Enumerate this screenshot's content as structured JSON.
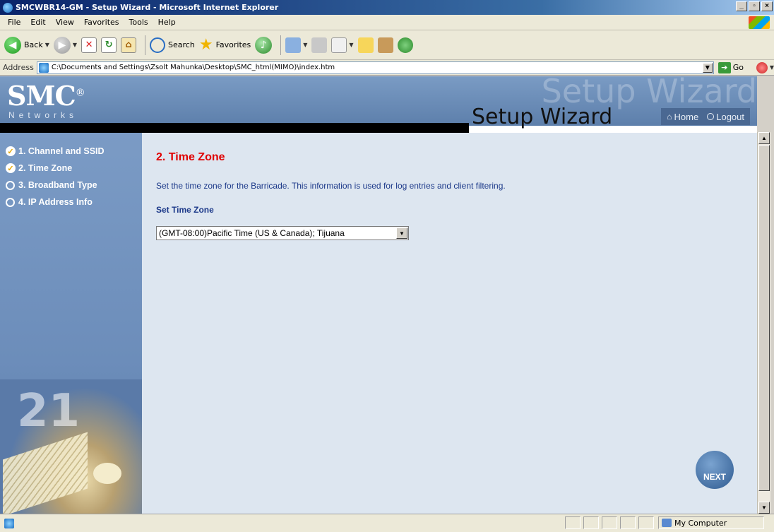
{
  "window": {
    "title": "SMCWBR14-GM - Setup Wizard - Microsoft Internet Explorer",
    "min": "_",
    "max": "▫",
    "close": "×"
  },
  "menu": {
    "items": [
      "File",
      "Edit",
      "View",
      "Favorites",
      "Tools",
      "Help"
    ]
  },
  "toolbar": {
    "back_label": "Back",
    "search_label": "Search",
    "favorites_label": "Favorites"
  },
  "address": {
    "label": "Address",
    "url": "C:\\Documents and Settings\\Zsolt Mahunka\\Desktop\\SMC_html(MIMO)\\index.htm",
    "go_label": "Go"
  },
  "header": {
    "logo": "SMC",
    "logo_mark": "®",
    "networks": "Networks",
    "ghost_title": "Setup Wizard",
    "title": "Setup Wizard",
    "home": "Home",
    "logout": "Logout"
  },
  "steps": [
    {
      "label": "1. Channel and SSID",
      "done": true
    },
    {
      "label": "2. Time Zone",
      "done": true
    },
    {
      "label": "3. Broadband Type",
      "done": false
    },
    {
      "label": "4. IP Address Info",
      "done": false
    }
  ],
  "art": {
    "text": "21"
  },
  "main": {
    "title": "2. Time Zone",
    "description": "Set the time zone for the Barricade. This information is used for log entries and client filtering.",
    "field_label": "Set Time Zone",
    "timezone_value": "(GMT-08:00)Pacific Time (US & Canada); Tijuana",
    "next_label": "NEXT"
  },
  "status": {
    "zone": "My Computer"
  },
  "colors": {
    "accent_red": "#e00000",
    "text_blue": "#1d3a8a",
    "sidebar_blue": "#6c8dba"
  }
}
